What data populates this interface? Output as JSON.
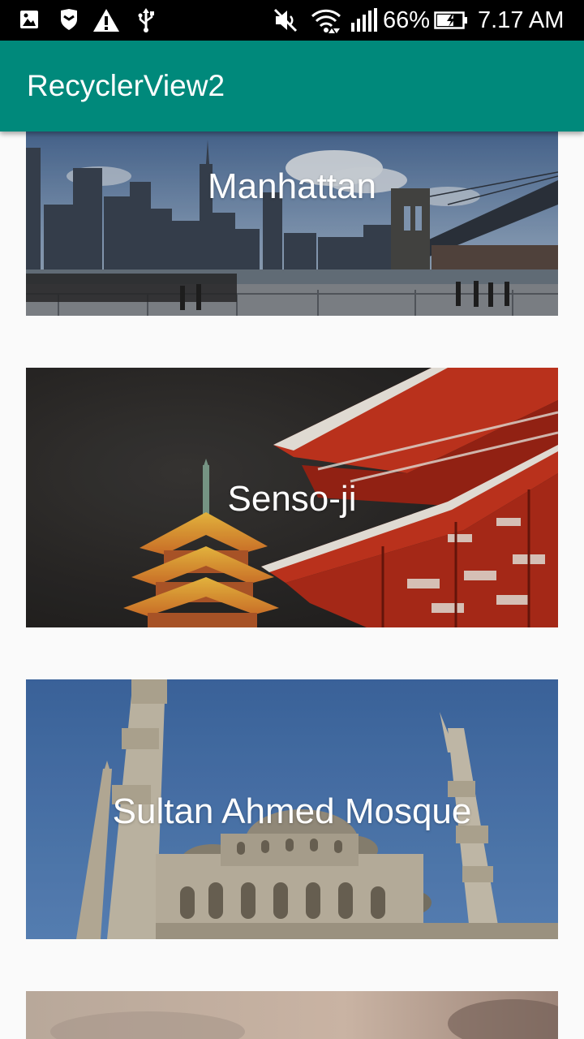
{
  "status_bar": {
    "icons": [
      "image-icon",
      "shield-icon",
      "warning-icon",
      "usb-icon",
      "mute-icon",
      "wifi-icon",
      "signal-icon",
      "battery-icon"
    ],
    "battery_percent": "66%",
    "battery_level": 0.66,
    "time": "7.17 AM"
  },
  "app_bar": {
    "title": "RecyclerView2",
    "color": "#00897b"
  },
  "list": {
    "items": [
      {
        "title": "Manhattan"
      },
      {
        "title": "Senso-ji"
      },
      {
        "title": "Sultan Ahmed Mosque"
      },
      {
        "title": ""
      }
    ]
  }
}
